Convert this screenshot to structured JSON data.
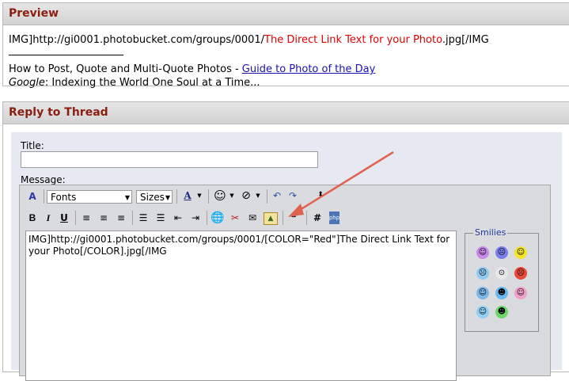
{
  "preview": {
    "title": "Preview",
    "line1_pre": "IMG]http://gi0001.photobucket.com/groups/0001/",
    "line1_red": "The Direct Link Text for your Photo",
    "line1_post": ".jpg[/IMG",
    "sig_text": "How to Post, Quote and Multi-Quote Photos - ",
    "sig_link": "Guide to Photo of the Day",
    "google_label": "Google",
    "google_text": ": Indexing the World One Soul at a Time..."
  },
  "reply": {
    "title": "Reply to Thread",
    "title_label": "Title:",
    "title_value": "",
    "message_label": "Message:",
    "fonts_select": "Fonts",
    "sizes_select": "Sizes",
    "message_text": "IMG]http://gi0001.photobucket.com/groups/0001/[COLOR=\"Red\"]The Direct Link Text for your Photo[/COLOR].jpg[/IMG",
    "smilies_label": "Smilies"
  },
  "toolbar_icons": {
    "bold": "B",
    "italic": "I",
    "underline": "U",
    "hash": "#",
    "php": "php"
  },
  "colors": {
    "panel_title": "#8a1f11",
    "red_text": "#e00000",
    "link": "#1a12b5",
    "arrow": "#e0624f"
  }
}
